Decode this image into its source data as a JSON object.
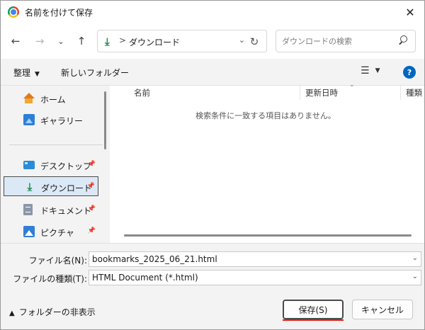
{
  "window": {
    "title": "名前を付けて保存"
  },
  "address": {
    "path": "ダウンロード",
    "separator": ">"
  },
  "search": {
    "placeholder": "ダウンロードの検索"
  },
  "toolbar": {
    "organize": "整理",
    "new_folder": "新しいフォルダー"
  },
  "sidebar": {
    "items": [
      {
        "label": "ホーム",
        "icon": "home-icon"
      },
      {
        "label": "ギャラリー",
        "icon": "gallery-icon"
      },
      {
        "label": "デスクトップ",
        "icon": "desktop-icon",
        "pinned": true
      },
      {
        "label": "ダウンロード",
        "icon": "download-icon",
        "pinned": true,
        "selected": true
      },
      {
        "label": "ドキュメント",
        "icon": "documents-icon",
        "pinned": true
      },
      {
        "label": "ピクチャ",
        "icon": "pictures-icon",
        "pinned": true
      }
    ]
  },
  "filelist": {
    "columns": [
      "名前",
      "更新日時",
      "種類"
    ],
    "empty_message": "検索条件に一致する項目はありません。"
  },
  "form": {
    "filename_label": "ファイル名(N):",
    "filename_value": "bookmarks_2025_06_21.html",
    "filetype_label": "ファイルの種類(T):",
    "filetype_value": "HTML Document (*.html)"
  },
  "footer": {
    "toggle_folders": "フォルダーの非表示",
    "save": "保存(S)",
    "cancel": "キャンセル"
  },
  "colors": {
    "accent": "#0067c0",
    "download_green": "#1c8a4a",
    "save_underline": "#e0201b"
  }
}
